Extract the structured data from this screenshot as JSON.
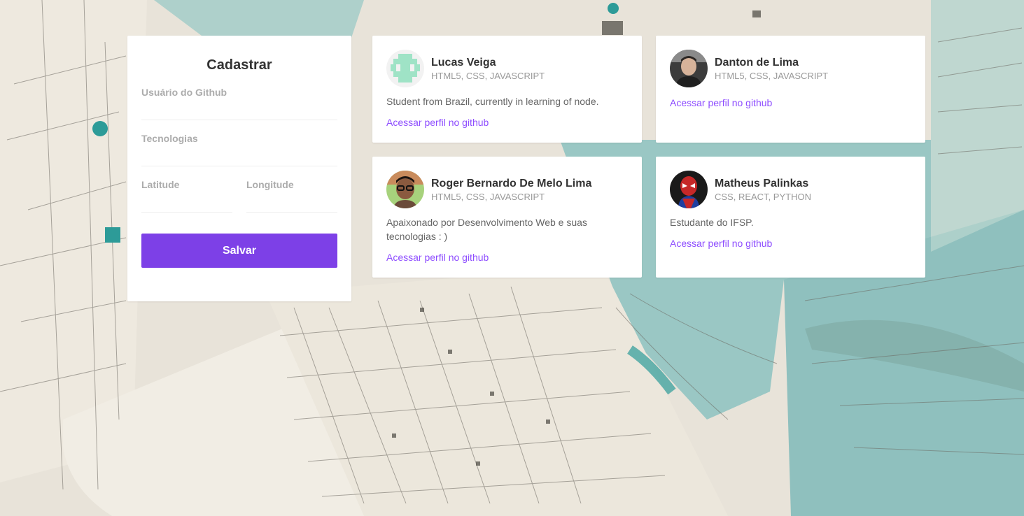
{
  "form": {
    "title": "Cadastrar",
    "github_user_label": "Usuário do Github",
    "github_user_value": "",
    "techs_label": "Tecnologias",
    "techs_value": "",
    "latitude_label": "Latitude",
    "latitude_value": "",
    "longitude_label": "Longitude",
    "longitude_value": "",
    "save_label": "Salvar"
  },
  "devs": [
    {
      "name": "Lucas Veiga",
      "techs": "HTML5, CSS, JAVASCRIPT",
      "bio": "Student from Brazil, currently in learning of node.",
      "link_label": "Acessar perfil no github",
      "avatar": "identicon-avatar"
    },
    {
      "name": "Danton de Lima",
      "techs": "HTML5, CSS, JAVASCRIPT",
      "bio": "",
      "link_label": "Acessar perfil no github",
      "avatar": "photo-avatar"
    },
    {
      "name": "Roger Bernardo De Melo Lima",
      "techs": "HTML5, CSS, JAVASCRIPT",
      "bio": "Apaixonado por Desenvolvimento Web e suas tecnologias : )",
      "link_label": "Acessar perfil no github",
      "avatar": "photo-avatar"
    },
    {
      "name": "Matheus Palinkas",
      "techs": "CSS, REACT, PYTHON",
      "bio": "Estudante do IFSP.",
      "link_label": "Acessar perfil no github",
      "avatar": "spiderman-avatar"
    }
  ],
  "colors": {
    "accent": "#7d40e7",
    "link": "#8e4dff",
    "map_water": "#8fc3c2",
    "map_paper": "#ece7dd"
  }
}
